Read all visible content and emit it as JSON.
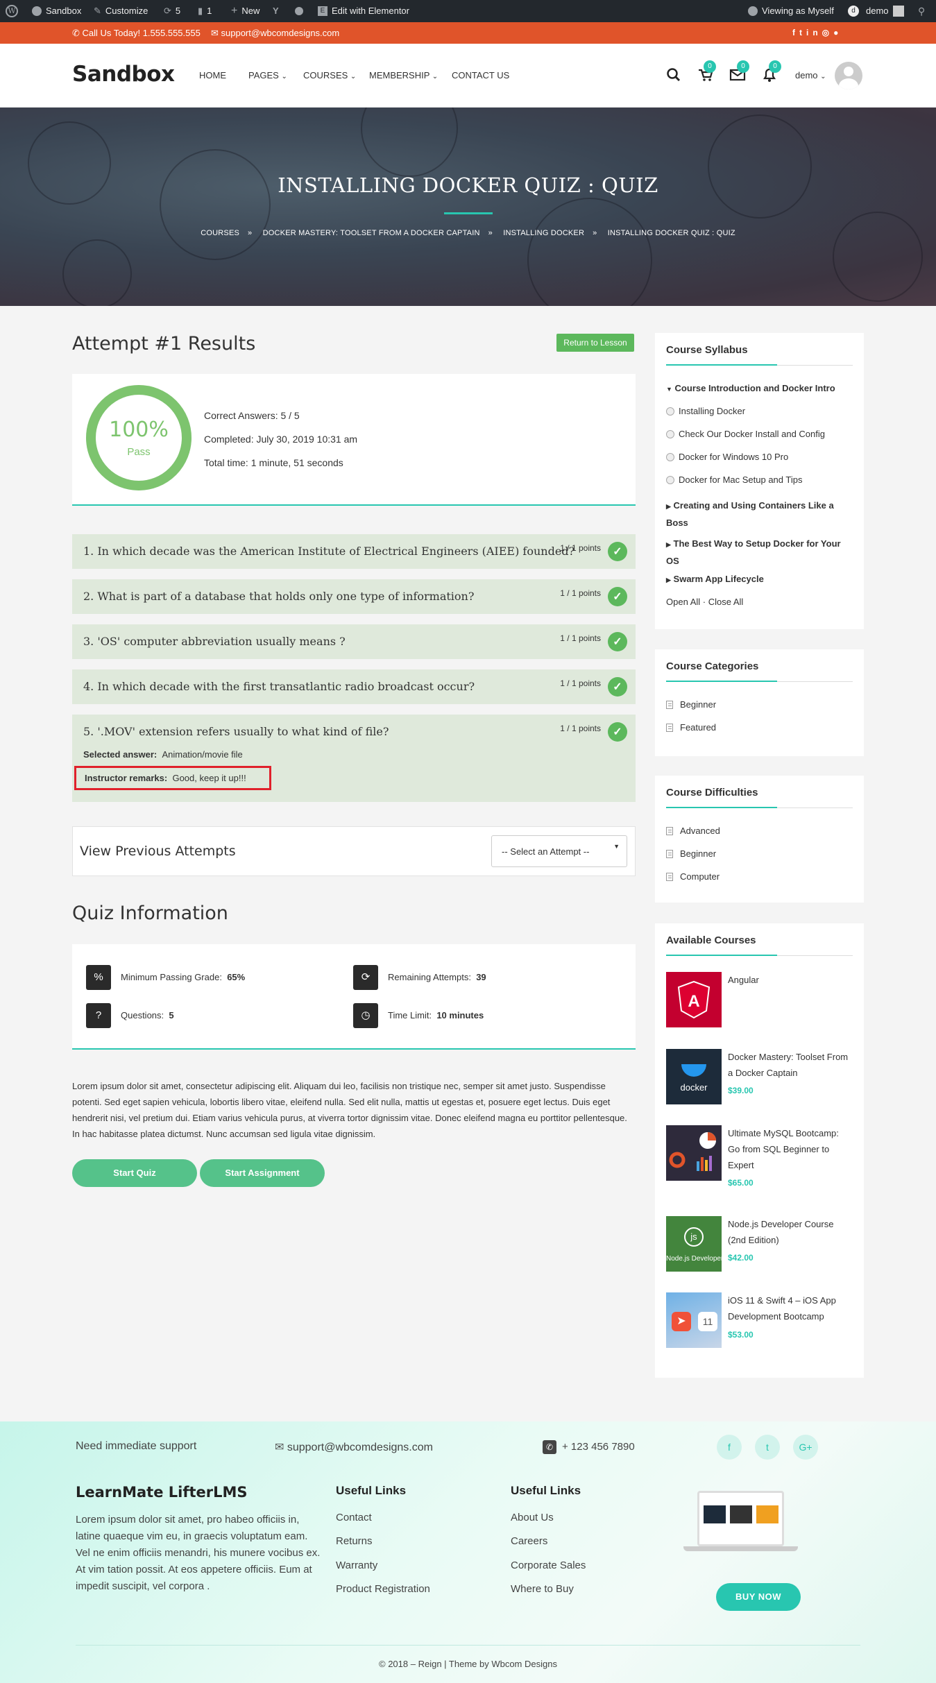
{
  "adminbar": {
    "site": "Sandbox",
    "customize": "Customize",
    "updates": "5",
    "comments": "1",
    "new": "New",
    "elementor": "Edit with Elementor",
    "viewing": "Viewing as Myself",
    "user": "demo"
  },
  "topbar": {
    "phone": "Call Us Today! 1.555.555.555",
    "email": "support@wbcomdesigns.com"
  },
  "header": {
    "logo": "Sandbox",
    "nav": [
      "HOME",
      "PAGES",
      "COURSES",
      "MEMBERSHIP",
      "CONTACT US"
    ],
    "cart_count": "0",
    "msg_count": "0",
    "notif_count": "0",
    "user": "demo"
  },
  "hero": {
    "title": "INSTALLING DOCKER QUIZ : QUIZ",
    "crumbs": [
      "COURSES",
      "DOCKER MASTERY: TOOLSET FROM A DOCKER CAPTAIN",
      "INSTALLING DOCKER",
      "INSTALLING DOCKER QUIZ : QUIZ"
    ]
  },
  "results": {
    "heading": "Attempt #1 Results",
    "return_btn": "Return to Lesson",
    "percent": "100%",
    "pass": "Pass",
    "score_fraction": 1.0,
    "correct": "Correct Answers: 5 / 5",
    "completed": "Completed: July 30, 2019 10:31 am",
    "total_time": "Total time: 1 minute, 51 seconds"
  },
  "questions": [
    {
      "text": "1. In which decade was the American Institute of Electrical Engineers (AIEE) founded?",
      "points": "1 / 1 points"
    },
    {
      "text": "2. What is part of a database that holds only one type of information?",
      "points": "1 / 1 points"
    },
    {
      "text": "3. 'OS' computer abbreviation usually means ?",
      "points": "1 / 1 points"
    },
    {
      "text": "4. In which decade with the first transatlantic radio broadcast occur?",
      "points": "1 / 1 points"
    },
    {
      "text": "5. '.MOV' extension refers usually to what kind of file?",
      "points": "1 / 1 points",
      "selected_label": "Selected answer:",
      "selected_value": "Animation/movie file",
      "remarks_label": "Instructor remarks:",
      "remarks_value": "Good, keep it up!!!"
    }
  ],
  "attempts": {
    "label": "View Previous Attempts",
    "select": "-- Select an Attempt --"
  },
  "quiz_info": {
    "heading": "Quiz Information",
    "passing_label": "Minimum Passing Grade:",
    "passing_value": "65%",
    "remaining_label": "Remaining Attempts:",
    "remaining_value": "39",
    "questions_label": "Questions:",
    "questions_value": "5",
    "time_label": "Time Limit:",
    "time_value": "10 minutes",
    "description": "Lorem ipsum dolor sit amet, consectetur adipiscing elit. Aliquam dui leo, facilisis non tristique nec, semper sit amet justo. Suspendisse potenti. Sed eget sapien vehicula, lobortis libero vitae, eleifend nulla. Sed elit nulla, mattis ut egestas et, posuere eget lectus. Duis eget hendrerit nisi, vel pretium dui. Etiam varius vehicula purus, at viverra tortor dignissim vitae. Donec eleifend magna eu porttitor pellentesque. In hac habitasse platea dictumst. Nunc accumsan sed ligula vitae dignissim.",
    "start_quiz": "Start Quiz",
    "start_assignment": "Start Assignment"
  },
  "syllabus": {
    "title": "Course Syllabus",
    "section1": "Course Introduction and Docker Intro",
    "lessons": [
      "Installing Docker",
      "Check Our Docker Install and Config",
      "Docker for Windows 10 Pro",
      "Docker for Mac Setup and Tips"
    ],
    "section2a": "Creating and Using Containers Like a",
    "section2b": "Boss",
    "section3a": "The Best Way to Setup Docker for Your",
    "section3b": "OS",
    "section4": "Swarm App Lifecycle",
    "open_all": "Open All",
    "close_all": "Close All"
  },
  "categories": {
    "title": "Course Categories",
    "items": [
      "Beginner",
      "Featured"
    ]
  },
  "difficulties": {
    "title": "Course Difficulties",
    "items": [
      "Advanced",
      "Beginner",
      "Computer"
    ]
  },
  "available": {
    "title": "Available Courses",
    "courses": [
      {
        "name": "Angular",
        "price": ""
      },
      {
        "name": "Docker Mastery: Toolset From a Docker Captain",
        "price": "$39.00"
      },
      {
        "name": "Ultimate MySQL Bootcamp: Go from SQL Beginner to Expert",
        "price": "$65.00"
      },
      {
        "name": "Node.js Developer Course (2nd Edition)",
        "price": "$42.00"
      },
      {
        "name": "iOS 11 & Swift 4 – iOS App Development Bootcamp",
        "price": "$53.00"
      }
    ],
    "thumb_text_docker": "docker",
    "thumb_text_node": "Node.js Developer",
    "thumb_text_ios": "11"
  },
  "footer": {
    "support": "Need immediate support",
    "email": "support@wbcomdesigns.com",
    "phone": "+ 123 456 7890",
    "brand": "LearnMate LifterLMS",
    "about": "Lorem ipsum dolor sit amet, pro habeo officiis in, latine quaeque vim eu, in graecis voluptatum eam. Vel ne enim officiis menandri, his munere vocibus ex. At vim tation possit. At eos appetere officiis. Eum at impedit suscipit, vel corpora .",
    "useful1_title": "Useful Links",
    "useful1": [
      "Contact",
      "Returns",
      "Warranty",
      "Product Registration"
    ],
    "useful2_title": "Useful Links",
    "useful2": [
      "About Us",
      "Careers",
      "Corporate Sales",
      "Where to Buy"
    ],
    "buy_now": "BUY NOW",
    "copyright": "© 2018 – Reign | Theme by Wbcom Designs"
  }
}
